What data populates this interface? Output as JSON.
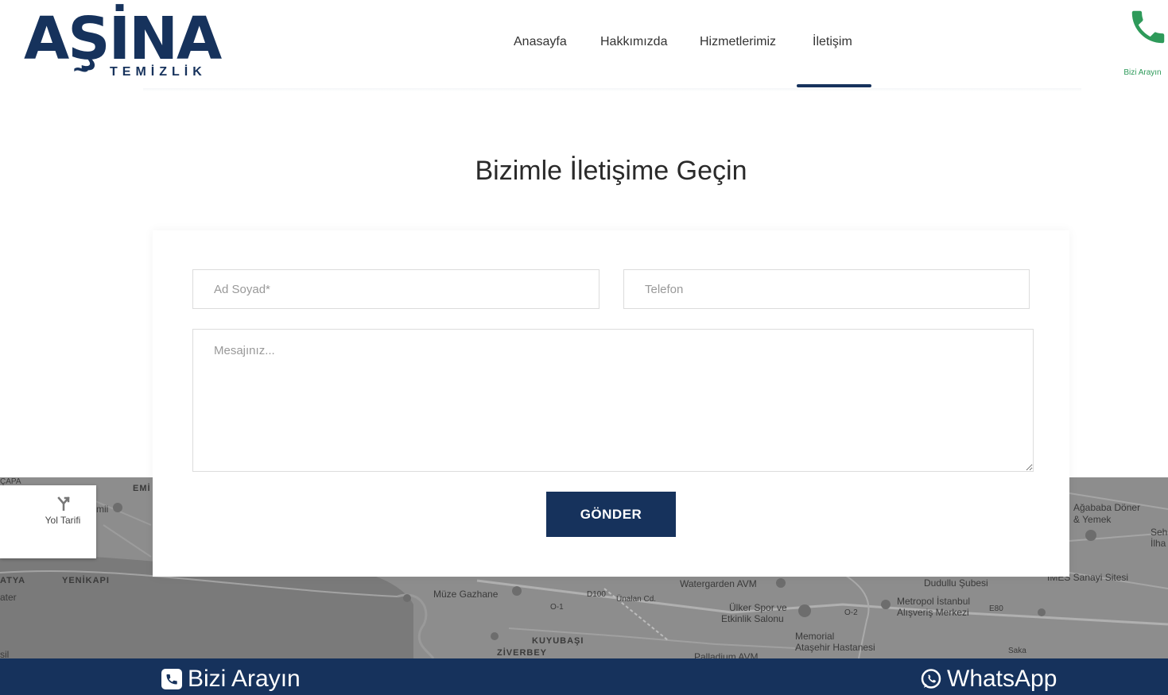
{
  "logo": {
    "main": "AŞİNA",
    "tilde": "~",
    "sub": "TEMİZLİK"
  },
  "nav": {
    "items": [
      {
        "label": "Anasayfa"
      },
      {
        "label": "Hakkımızda"
      },
      {
        "label": "Hizmetlerimiz"
      },
      {
        "label": "İletişim",
        "active": true
      }
    ]
  },
  "header_call": {
    "icon": "phone-icon",
    "label": "Bizi Arayın"
  },
  "page": {
    "title": "Bizimle İletişime Geçin"
  },
  "form": {
    "name_placeholder": "Ad Soyad*",
    "name_value": "",
    "phone_placeholder": "Telefon",
    "phone_value": "",
    "message_placeholder": "Mesajınız...",
    "message_value": "",
    "submit_label": "GÖNDER"
  },
  "map": {
    "directions_label": "Yol Tarifi",
    "labels": [
      "ÇAPA",
      "EMİ",
      "mii",
      "ATYA",
      "YENİKAPI",
      "ater",
      "sil",
      "Müze Gazhane",
      "D100",
      "Ünalan Cd.",
      "O-1",
      "KUYUBAŞI",
      "ZİVERBEY",
      "Watergarden AVM",
      "Ülker Spor ve",
      "Etkinlik Salonu",
      "Memorial",
      "Ataşehir Hastanesi",
      "Palladium AVM",
      "O-2",
      "Metropol İstanbul",
      "Alışveriş Merkezi",
      "E80",
      "Dudullu Şubesi",
      "İMES Sanayi Sitesi",
      "Ağababa Döner",
      "& Yemek",
      "Seh",
      "İlha",
      "Saka"
    ]
  },
  "bottom_bar": {
    "call_label": "Bizi Arayın",
    "whatsapp_label": "WhatsApp"
  },
  "colors": {
    "brand_navy": "#16325c",
    "call_green": "#2e9a5a",
    "map_gray": "#8b8b8b"
  }
}
